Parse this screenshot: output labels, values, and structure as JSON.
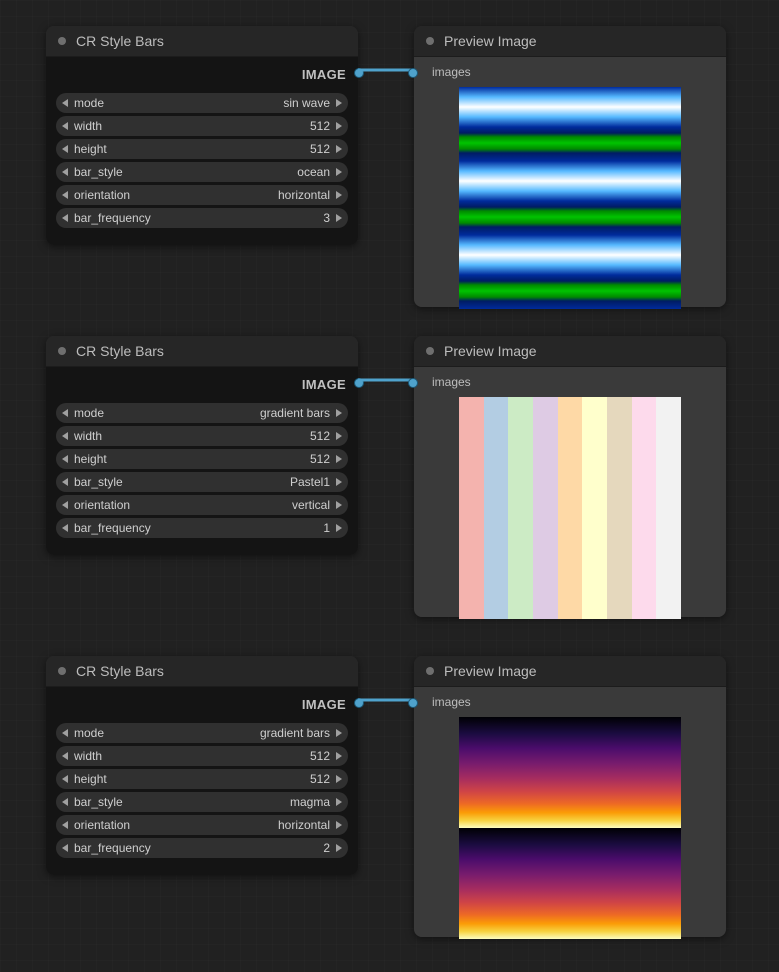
{
  "nodes": [
    {
      "title": "CR Style Bars",
      "output": "IMAGE",
      "params": [
        {
          "name": "mode",
          "value": "sin wave"
        },
        {
          "name": "width",
          "value": "512"
        },
        {
          "name": "height",
          "value": "512"
        },
        {
          "name": "bar_style",
          "value": "ocean"
        },
        {
          "name": "orientation",
          "value": "horizontal"
        },
        {
          "name": "bar_frequency",
          "value": "3"
        }
      ],
      "preview_title": "Preview Image",
      "preview_input": "images"
    },
    {
      "title": "CR Style Bars",
      "output": "IMAGE",
      "params": [
        {
          "name": "mode",
          "value": "gradient bars"
        },
        {
          "name": "width",
          "value": "512"
        },
        {
          "name": "height",
          "value": "512"
        },
        {
          "name": "bar_style",
          "value": "Pastel1"
        },
        {
          "name": "orientation",
          "value": "vertical"
        },
        {
          "name": "bar_frequency",
          "value": "1"
        }
      ],
      "preview_title": "Preview Image",
      "preview_input": "images"
    },
    {
      "title": "CR Style Bars",
      "output": "IMAGE",
      "params": [
        {
          "name": "mode",
          "value": "gradient bars"
        },
        {
          "name": "width",
          "value": "512"
        },
        {
          "name": "height",
          "value": "512"
        },
        {
          "name": "bar_style",
          "value": "magma"
        },
        {
          "name": "orientation",
          "value": "horizontal"
        },
        {
          "name": "bar_frequency",
          "value": "2"
        }
      ],
      "preview_title": "Preview Image",
      "preview_input": "images"
    }
  ],
  "pastel_colors": [
    "#f4b3ae",
    "#b3cde3",
    "#ccebc5",
    "#decbe4",
    "#fed9a6",
    "#ffffcc",
    "#e5d8bd",
    "#fddaec",
    "#f2f2f2"
  ]
}
